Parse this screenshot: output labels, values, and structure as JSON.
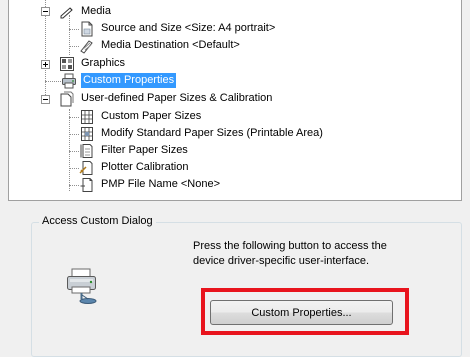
{
  "tree": {
    "items": [
      {
        "label": "Media",
        "icon": "media-pencil-icon"
      },
      {
        "label": "Source and Size <Size: A4 portrait>",
        "icon": "page-size-icon"
      },
      {
        "label": "Media Destination <Default>",
        "icon": "media-destination-icon"
      },
      {
        "label": "Graphics",
        "icon": "graphics-icon"
      },
      {
        "label": "Custom Properties",
        "icon": "custom-properties-printer-icon",
        "selected": true
      },
      {
        "label": "User-defined Paper Sizes & Calibration",
        "icon": "paper-sizes-icon"
      },
      {
        "label": "Custom Paper Sizes",
        "icon": "custom-paper-sizes-icon"
      },
      {
        "label": "Modify Standard Paper Sizes (Printable Area)",
        "icon": "modify-paper-sizes-icon"
      },
      {
        "label": "Filter Paper Sizes",
        "icon": "filter-paper-icon"
      },
      {
        "label": "Plotter Calibration",
        "icon": "plotter-calibration-icon"
      },
      {
        "label": "PMP File Name <None>",
        "icon": "pmp-file-icon"
      }
    ]
  },
  "access_group": {
    "title": "Access Custom Dialog",
    "instructions": "Press the following button to access the device driver-specific user-interface.",
    "button_label": "Custom Properties..."
  },
  "colors": {
    "selection": "#3399ff",
    "highlight_border": "#e8141d"
  }
}
